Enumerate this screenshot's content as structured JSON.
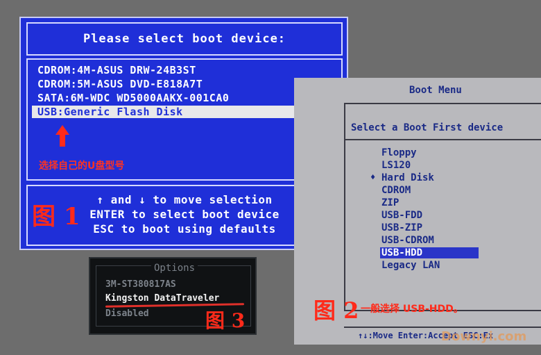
{
  "figure1": {
    "title": "Please select boot device:",
    "devices": [
      "CDROM:4M-ASUS DRW-24B3ST",
      "CDROM:5M-ASUS DVD-E818A7T",
      "SATA:6M-WDC WD5000AAKX-001CA0",
      "USB:Generic Flash Disk"
    ],
    "annotation": "选择自己的U盘型号",
    "help": [
      "↑ and ↓ to move selection",
      "ENTER to select boot device",
      "ESC to boot using defaults"
    ],
    "label": "图 1",
    "accent_color": "#1f2fd8",
    "annotation_color": "#ff2a1a"
  },
  "figure2": {
    "title": "Boot Menu",
    "subtitle": "Select a Boot First device",
    "items": [
      "Floppy",
      "LS120",
      "Hard Disk",
      "CDROM",
      "ZIP",
      "USB-FDD",
      "USB-ZIP",
      "USB-CDROM",
      "USB-HDD",
      "Legacy LAN"
    ],
    "footer": "↑↓:Move Enter:Accept ESC:Ex",
    "label": "图 2",
    "note": "一般选择 USB-HDD。",
    "watermark": "Downyi.com"
  },
  "figure3": {
    "title": "Options",
    "items": [
      "3M-ST380817AS",
      "Kingston DataTraveler",
      "Disabled"
    ],
    "label": "图 3"
  }
}
